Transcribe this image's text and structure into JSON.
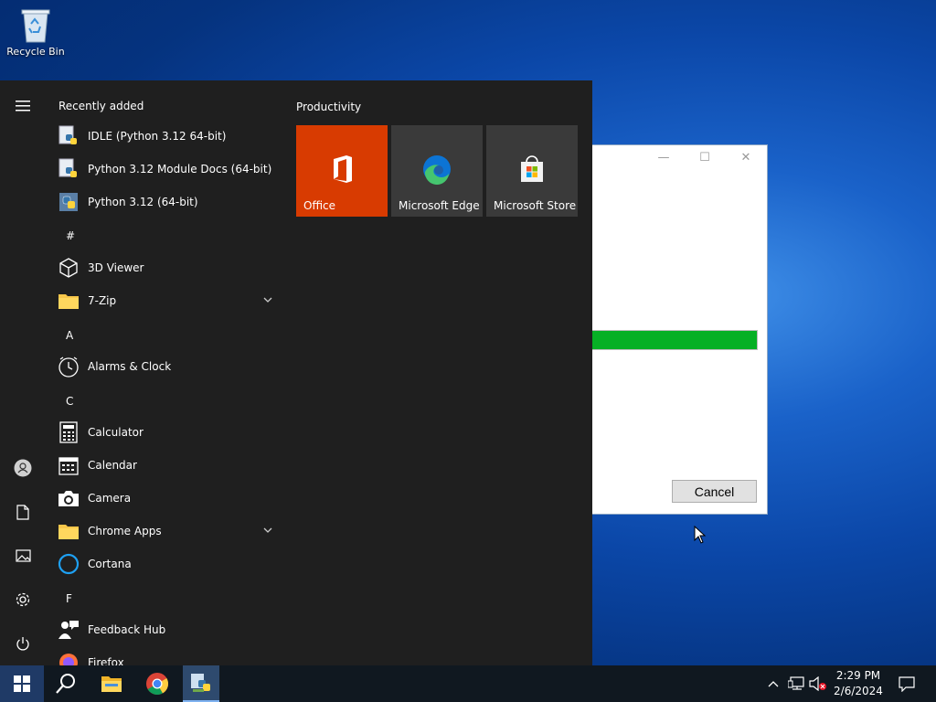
{
  "desktop": {
    "recycle_bin_label": "Recycle Bin"
  },
  "dialog": {
    "cancel_label": "Cancel",
    "progress": 1.0,
    "progress_color": "#06b025",
    "minimize_glyph": "—",
    "maximize_glyph": "☐",
    "close_glyph": "✕"
  },
  "start_menu": {
    "recently_added_title": "Recently added",
    "recent": [
      {
        "label": "IDLE (Python 3.12 64-bit)",
        "icon": "python-idle-icon"
      },
      {
        "label": "Python 3.12 Module Docs (64-bit)",
        "icon": "python-docs-icon"
      },
      {
        "label": "Python 3.12 (64-bit)",
        "icon": "python-icon"
      }
    ],
    "groups": [
      {
        "letter": "#",
        "apps": [
          {
            "label": "3D Viewer",
            "icon": "cube-icon"
          },
          {
            "label": "7-Zip",
            "icon": "folder-icon",
            "expandable": true
          }
        ]
      },
      {
        "letter": "A",
        "apps": [
          {
            "label": "Alarms & Clock",
            "icon": "clock-icon"
          }
        ]
      },
      {
        "letter": "C",
        "apps": [
          {
            "label": "Calculator",
            "icon": "calculator-icon"
          },
          {
            "label": "Calendar",
            "icon": "calendar-icon"
          },
          {
            "label": "Camera",
            "icon": "camera-icon"
          },
          {
            "label": "Chrome Apps",
            "icon": "folder-icon",
            "expandable": true
          },
          {
            "label": "Cortana",
            "icon": "cortana-icon"
          }
        ]
      },
      {
        "letter": "F",
        "apps": [
          {
            "label": "Feedback Hub",
            "icon": "feedback-icon"
          },
          {
            "label": "Firefox",
            "icon": "firefox-icon"
          }
        ]
      }
    ],
    "tiles_group_title": "Productivity",
    "tiles": [
      {
        "label": "Office",
        "icon": "office-icon",
        "color": "#d83b01"
      },
      {
        "label": "Microsoft Edge",
        "icon": "edge-icon",
        "color": "#3a3a3a"
      },
      {
        "label": "Microsoft Store",
        "icon": "store-icon",
        "color": "#3a3a3a"
      }
    ],
    "rail_icons": [
      "hamburger-icon",
      "user-icon",
      "document-icon",
      "pictures-icon",
      "settings-icon",
      "power-icon"
    ]
  },
  "taskbar": {
    "buttons": [
      "start-icon",
      "search-icon",
      "file-explorer-icon",
      "chrome-icon",
      "python-installer-icon"
    ],
    "tray": [
      "chevron-up-icon",
      "network-icon",
      "volume-muted-icon",
      "notification-icon"
    ],
    "time": "2:29 PM",
    "date": "2/6/2024"
  },
  "colors": {
    "start_bg": "#1f1f1f",
    "taskbar_bg": "#101820",
    "accent_green": "#06b025",
    "office_orange": "#d83b01"
  }
}
